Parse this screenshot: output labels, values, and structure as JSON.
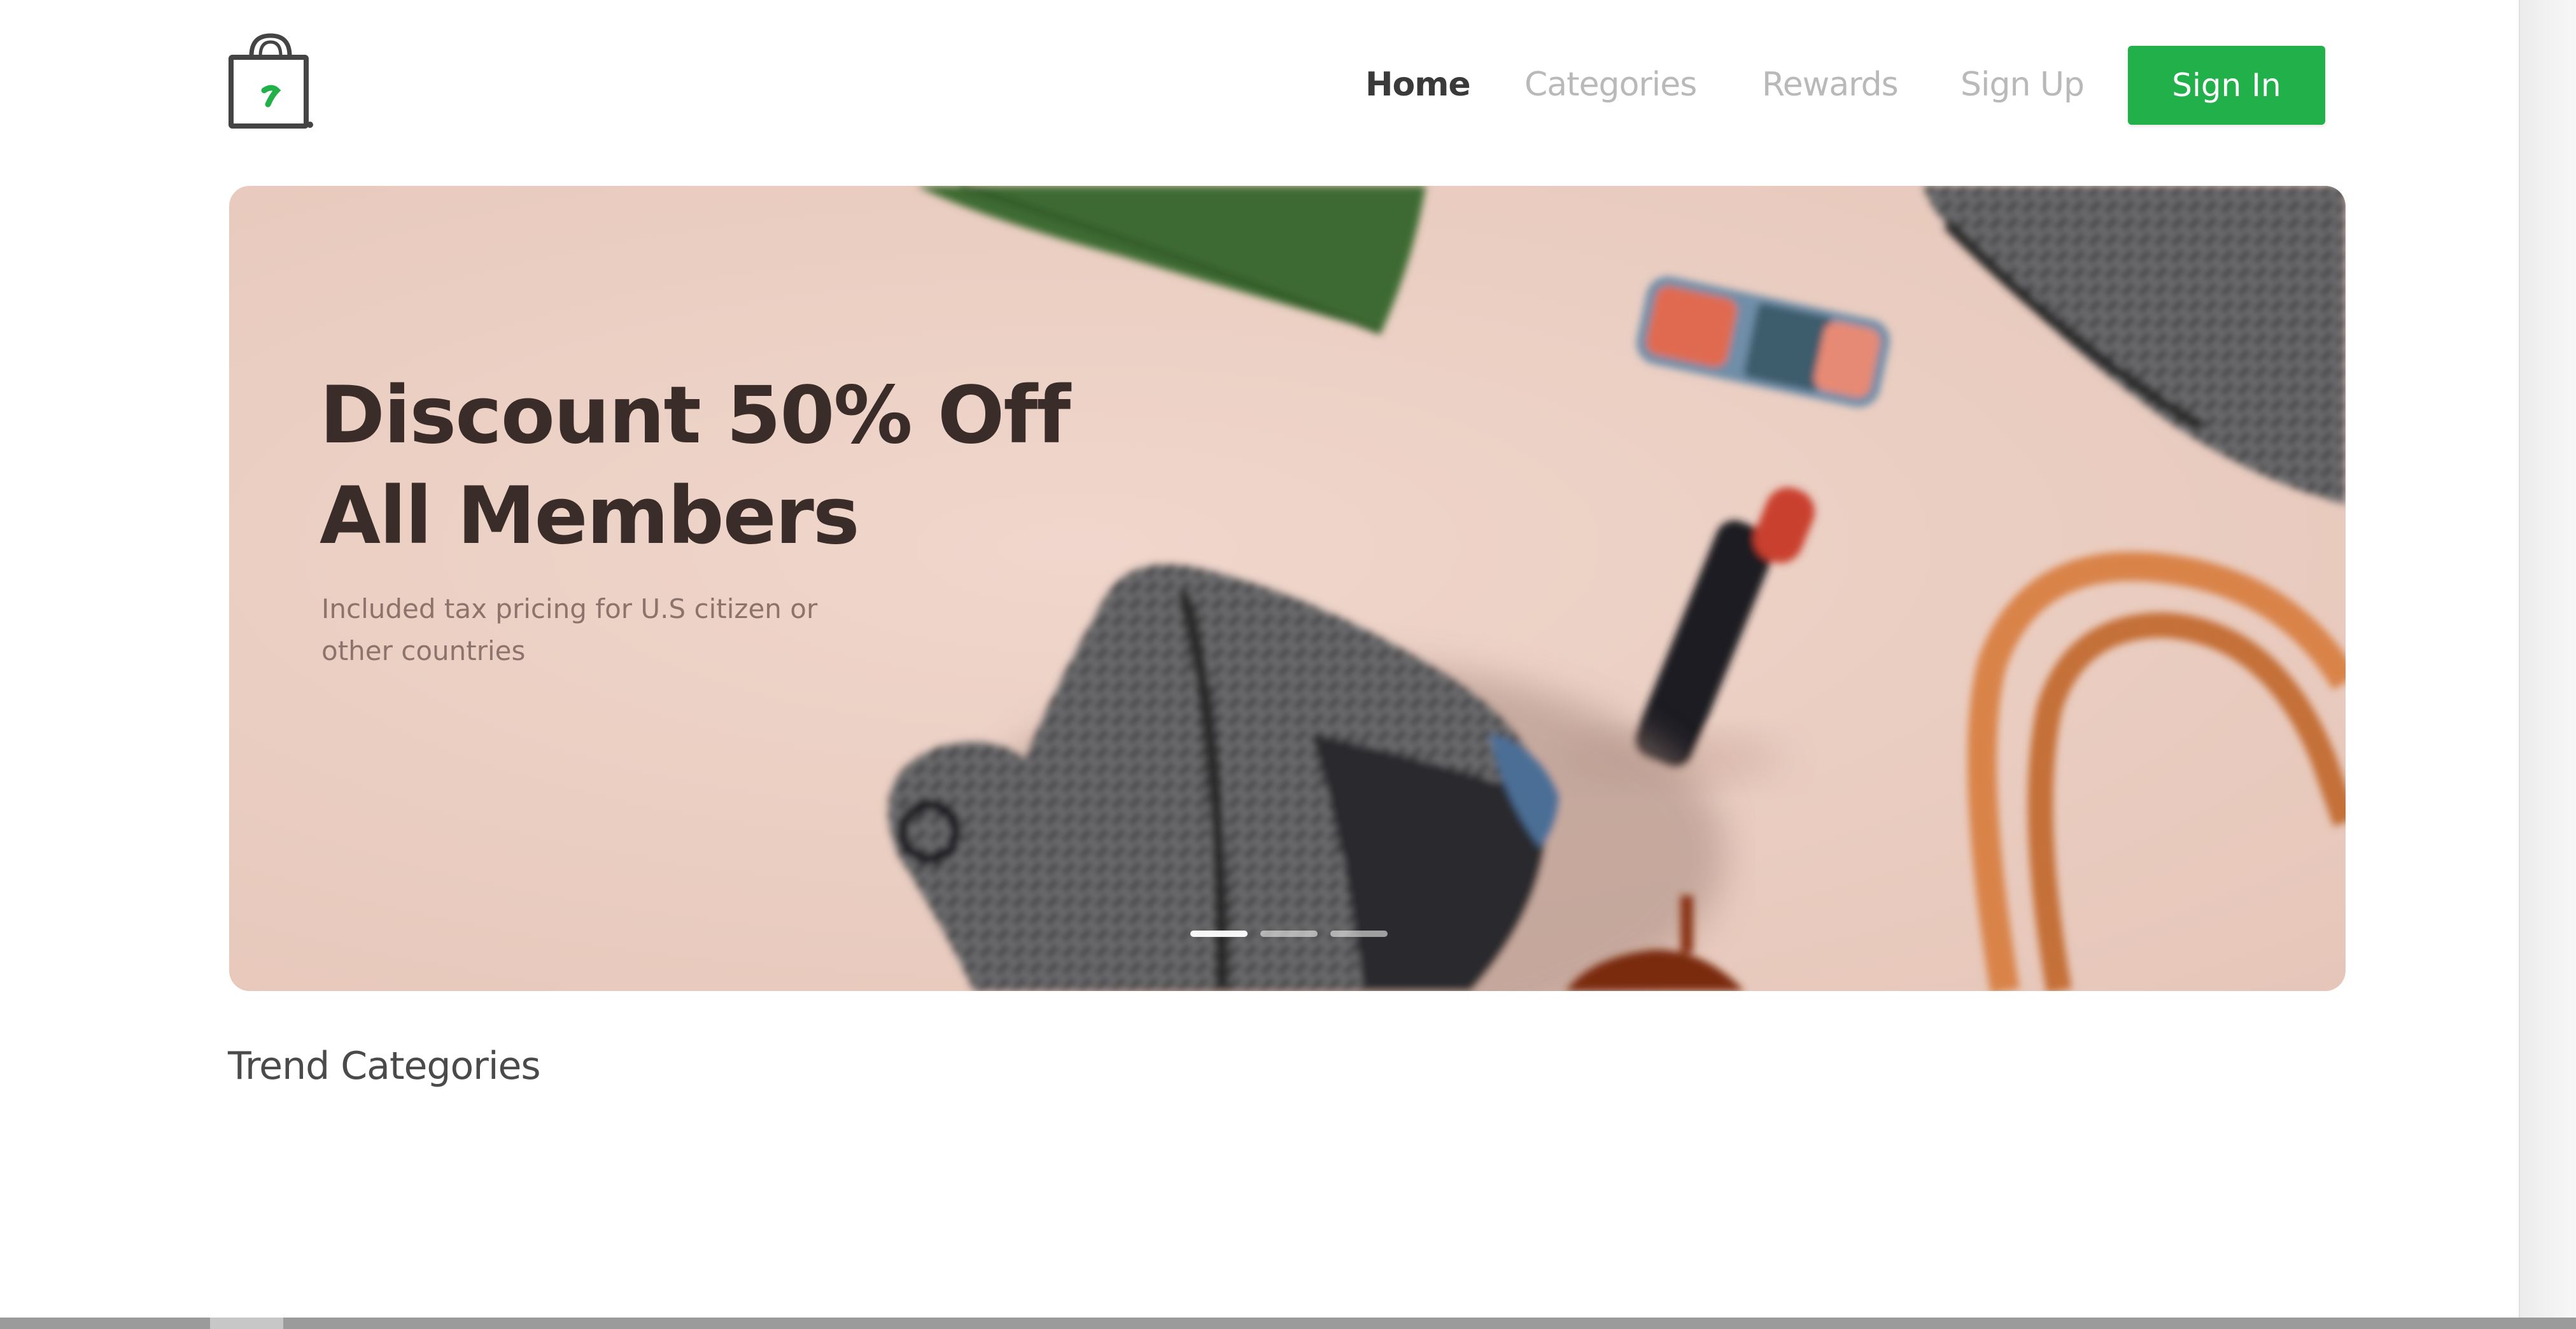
{
  "brand": {
    "logo_icon": "shopping-bag-icon",
    "accent": "#21b04a"
  },
  "nav": {
    "home": "Home",
    "categories": "Categories",
    "rewards": "Rewards",
    "signup": "Sign Up",
    "signin": "Sign In"
  },
  "hero": {
    "title_line1": "Discount 50% Off",
    "title_line2": "All Members",
    "subtitle": "Included tax pricing for U.S citizen or other countries",
    "slides_count": 3,
    "active_slide": 1,
    "background_color": "#ebcfc3"
  },
  "sections": {
    "trend_heading": "Trend Categories"
  }
}
